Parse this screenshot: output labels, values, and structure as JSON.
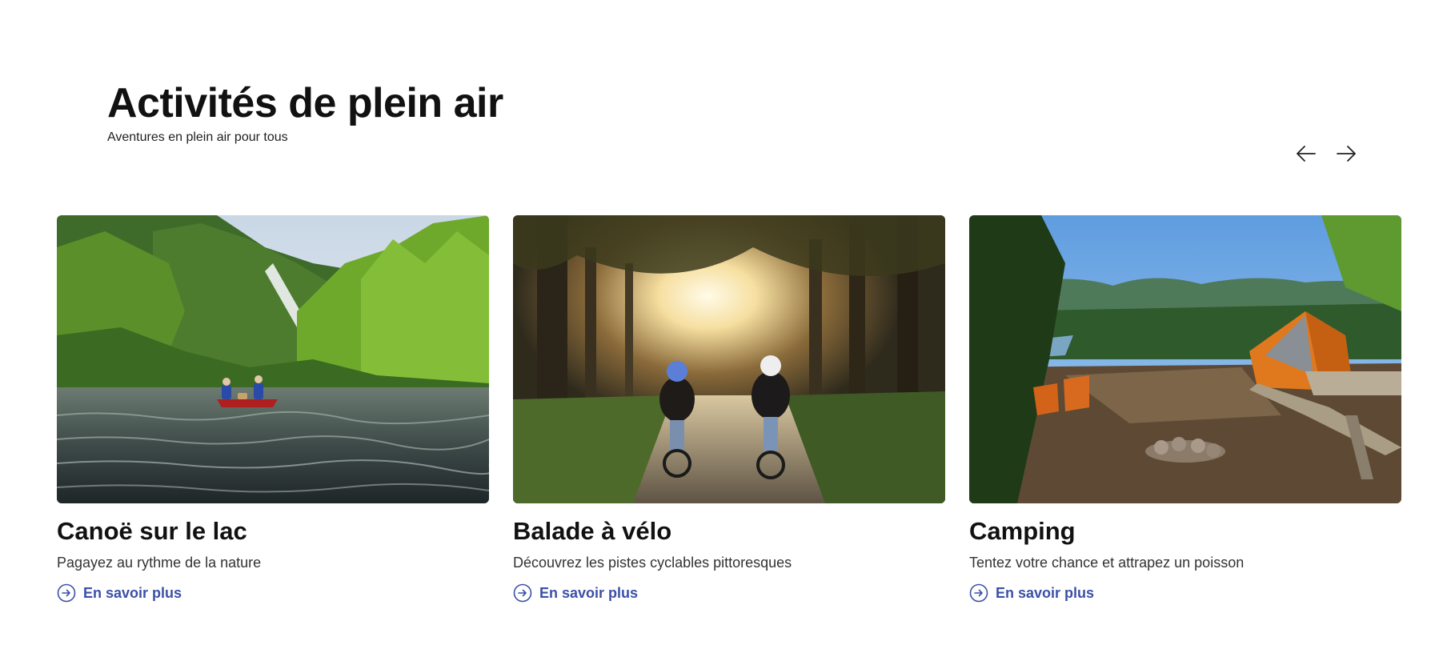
{
  "section": {
    "title": "Activités de plein air",
    "subtitle": "Aventures en plein air pour tous"
  },
  "navigation": {
    "previous_icon": "arrow-left-icon",
    "next_icon": "arrow-right-icon"
  },
  "cards": [
    {
      "image": "canoe-on-river-photo",
      "title": "Canoë sur le lac",
      "description": "Pagayez au rythme de la nature",
      "link_label": "En savoir plus",
      "link_icon": "arrow-circle-right-icon"
    },
    {
      "image": "kids-biking-forest-path-photo",
      "title": "Balade à vélo",
      "description": "Découvrez les pistes cyclables pittoresques",
      "link_label": "En savoir plus",
      "link_icon": "arrow-circle-right-icon"
    },
    {
      "image": "campsite-tent-photo",
      "title": "Camping",
      "description": "Tentez votre chance et attrapez un poisson",
      "link_label": "En savoir plus",
      "link_icon": "arrow-circle-right-icon"
    }
  ],
  "colors": {
    "link": "#3b50a8",
    "title": "#111111",
    "text": "#333333",
    "background": "#ffffff"
  }
}
